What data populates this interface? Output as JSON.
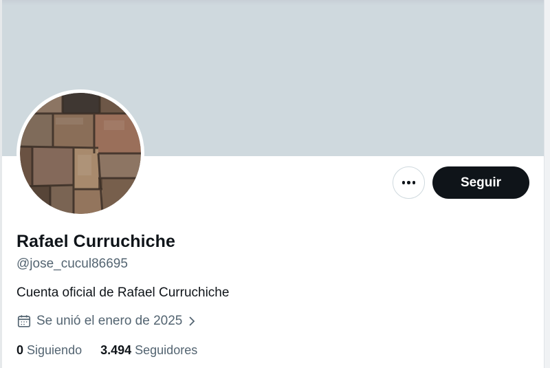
{
  "profile": {
    "display_name": "Rafael Curruchiche",
    "handle": "@jose_cucul86695",
    "bio": "Cuenta oficial de Rafael Curruchiche",
    "joined": "Se unió el enero de 2025",
    "following_count": "0",
    "following_label": "Siguiendo",
    "followers_count": "3.494",
    "followers_label": "Seguidores"
  },
  "actions": {
    "follow_label": "Seguir"
  },
  "icons": {
    "more": "more-horizontal-icon",
    "joined": "calendar-icon",
    "joined_chevron": "chevron-right-icon"
  },
  "colors": {
    "banner": "#cfd9de",
    "primary_text": "#0f1419",
    "secondary_text": "#536471",
    "follow_button_bg": "#0f1419",
    "follow_button_text": "#ffffff",
    "border": "#cfd9de"
  }
}
